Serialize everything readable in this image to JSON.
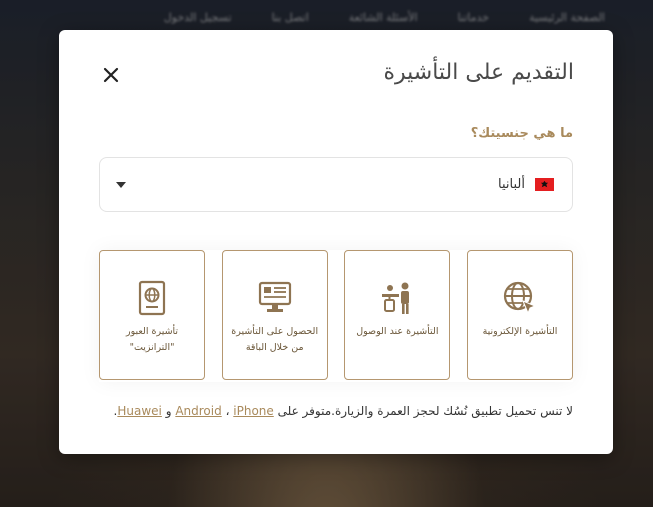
{
  "background": {
    "nav_items": [
      "الصفحة الرئيسية",
      "خدماتنا",
      "الأسئلة الشائعة",
      "اتصل بنا",
      "تسجيل الدخول"
    ]
  },
  "modal": {
    "title": "التقديم على التأشيرة",
    "close_icon": "close-icon",
    "nationality_question": "ما هي جنسيتك؟",
    "nationality": {
      "selected": "ألبانيا",
      "flag_icon": "albania-flag-icon",
      "flag_color": "#e41e20"
    },
    "accent_color": "#a98a5c",
    "cards": [
      {
        "label": "التأشيرة الإلكترونية",
        "icon": "globe-cursor-icon"
      },
      {
        "label": "التأشيرة عند الوصول",
        "icon": "traveler-desk-icon"
      },
      {
        "label": "الحصول على التأشيرة من خلال الباقة",
        "icon": "computer-screen-icon"
      },
      {
        "label": "تأشيرة العبور \"الترانزيت\"",
        "icon": "passport-icon"
      }
    ],
    "footer": {
      "text": "لا تنس تحميل تطبيق نُسُك لحجز العمرة والزيارة.متوفر على",
      "android": "Android",
      "sep1": "،",
      "iphone": "iPhone",
      "and": "و",
      "huawei": "Huawei",
      "end": "."
    }
  }
}
